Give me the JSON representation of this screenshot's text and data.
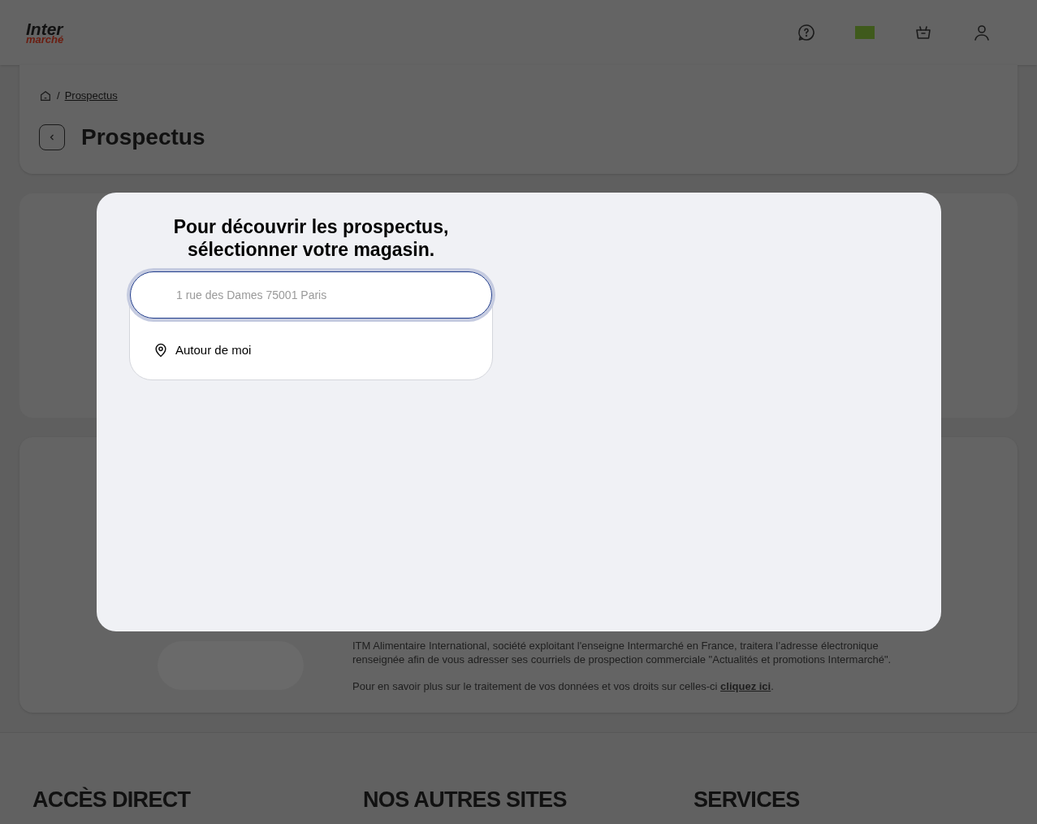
{
  "header": {
    "logo": {
      "top": "Inter",
      "bottom": "marché"
    }
  },
  "breadcrumb": {
    "separator": "/",
    "current": "Prospectus"
  },
  "page_title": "Prospectus",
  "consent": {
    "paragraph": "ITM Alimentaire International, société exploitant l'enseigne Intermarché en France, traitera l’adresse électronique renseignée afin de vous adresser ses courriels de prospection commerciale \"Actualités et promotions Intermarché\".",
    "more_text": "Pour en savoir plus sur le traitement de vos données et vos droits sur celles-ci",
    "more_link": "cliquez ici",
    "more_end": "."
  },
  "footer": {
    "headings": [
      "ACCÈS DIRECT",
      "NOS AUTRES SITES",
      "SERVICES"
    ]
  },
  "modal": {
    "title_lines": [
      "Pour découvrir les prospectus,",
      "sélectionner votre magasin."
    ],
    "search": {
      "placeholder": "1 rue des Dames 75001 Paris"
    },
    "options": [
      "Autour de moi"
    ]
  }
}
